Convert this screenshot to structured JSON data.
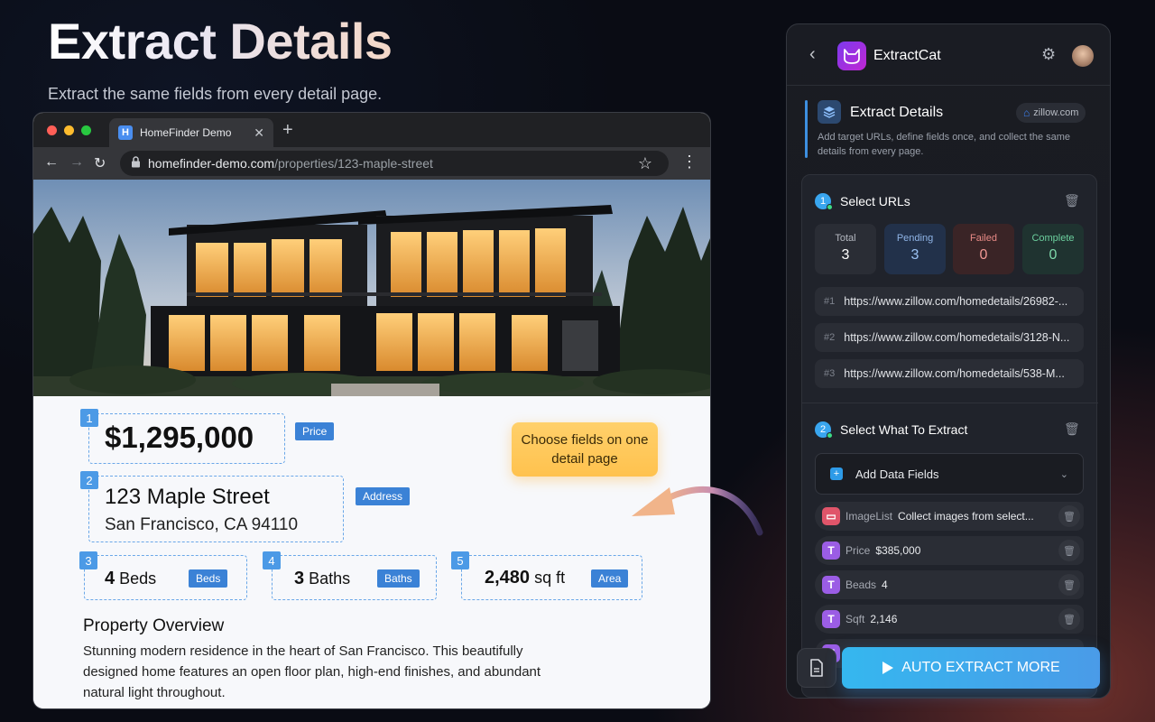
{
  "hero": {
    "title": "Extract Details",
    "subtitle": "Extract the same fields from every detail page."
  },
  "browser": {
    "tab_title": "HomeFinder Demo",
    "tab_favicon": "H",
    "url_host": "homefinder-demo.com",
    "url_path": "/properties/123-maple-street"
  },
  "listing": {
    "price": "$1,295,000",
    "price_tag": "Price",
    "street": "123 Maple Street",
    "city": "San Francisco, CA 94110",
    "address_tag": "Address",
    "beds_num": "4",
    "beds_unit": "Beds",
    "beds_tag": "Beds",
    "baths_num": "3",
    "baths_unit": "Baths",
    "baths_tag": "Baths",
    "area_num": "2,480",
    "area_unit": "sq ft",
    "area_tag": "Area",
    "badges": [
      "1",
      "2",
      "3",
      "4",
      "5"
    ],
    "callout": "Choose fields on one detail page",
    "overview_title": "Property Overview",
    "overview_text": "Stunning modern residence in the heart of San Francisco. This beautifully designed home features an open floor plan, high-end finishes, and abundant natural light throughout."
  },
  "panel": {
    "app_name": "ExtractCat",
    "section_title": "Extract Details",
    "site_chip": "zillow.com",
    "section_desc": "Add target URLs, define fields once, and collect the same details from every page.",
    "step1": {
      "num": "1",
      "title": "Select URLs"
    },
    "stats": [
      {
        "label": "Total",
        "value": "3",
        "bg": "#2a2d35",
        "label_color": "#b4b8c0",
        "value_color": "#ffffff"
      },
      {
        "label": "Pending",
        "value": "3",
        "bg": "#22314a",
        "label_color": "#8fb4e6",
        "value_color": "#9cc2f2"
      },
      {
        "label": "Failed",
        "value": "0",
        "bg": "#3a2426",
        "label_color": "#e88a86",
        "value_color": "#f09894"
      },
      {
        "label": "Complete",
        "value": "0",
        "bg": "#1f3330",
        "label_color": "#6ccf9e",
        "value_color": "#7ed8aa"
      }
    ],
    "urls": [
      {
        "idx": "#1",
        "url": "https://www.zillow.com/homedetails/26982-..."
      },
      {
        "idx": "#2",
        "url": "https://www.zillow.com/homedetails/3128-N..."
      },
      {
        "idx": "#3",
        "url": "https://www.zillow.com/homedetails/538-M..."
      }
    ],
    "step2": {
      "num": "2",
      "title": "Select What To Extract"
    },
    "add_fields_label": "Add Data Fields",
    "fields": [
      {
        "name": "ImageList",
        "value": "Collect images from select...",
        "icon": "image-icon",
        "color": "#e0556a"
      },
      {
        "name": "Price",
        "value": "$385,000",
        "icon": "text-icon",
        "color": "#9b5de5"
      },
      {
        "name": "Beads",
        "value": "4",
        "icon": "text-icon",
        "color": "#9b5de5"
      },
      {
        "name": "Sqft",
        "value": "2,146",
        "icon": "text-icon",
        "color": "#9b5de5"
      }
    ],
    "auto_button": "AUTO EXTRACT MORE"
  }
}
